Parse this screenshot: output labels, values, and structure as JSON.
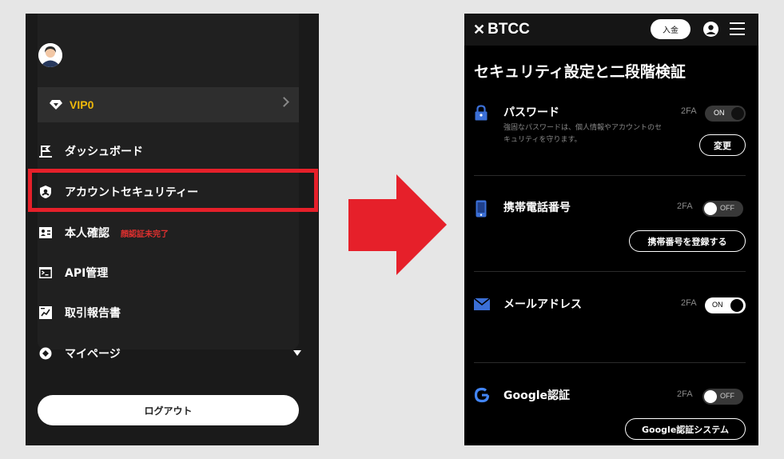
{
  "left_menu": {
    "vip_label": "VIP0",
    "items": [
      {
        "label": "ダッシュボード",
        "icon": "dashboard-icon"
      },
      {
        "label": "アカウントセキュリティー",
        "icon": "shield-icon"
      },
      {
        "label": "本人確認",
        "icon": "id-card-icon",
        "warning": "顔認証未完了"
      },
      {
        "label": "API管理",
        "icon": "terminal-icon"
      },
      {
        "label": "取引報告書",
        "icon": "report-icon"
      }
    ],
    "my_page": "マイページ",
    "logout": "ログアウト"
  },
  "right_panel": {
    "logo": "BTCC",
    "deposit_label": "入金",
    "page_title": "セキュリティ設定と二段階検証",
    "sections": [
      {
        "title": "パスワード",
        "badge": "2FA",
        "toggle": "ON",
        "description": "強固なパスワードは、個人情報やアカウントのセキュリティを守ります。",
        "button": "変更"
      },
      {
        "title": "携帯電話番号",
        "badge": "2FA",
        "toggle": "OFF",
        "button": "携帯番号を登録する"
      },
      {
        "title": "メールアドレス",
        "badge": "2FA",
        "toggle": "ON"
      },
      {
        "title": "Google認証",
        "badge": "2FA",
        "toggle": "OFF",
        "button": "Google認証システム"
      }
    ]
  },
  "colors": {
    "vip_gold": "#f0b90b",
    "warning_red": "#e0302f",
    "highlight_red": "#e6202a",
    "arrow_red": "#e6202a",
    "lock_blue": "#3b6fd6",
    "google_blue": "#4285f4"
  }
}
